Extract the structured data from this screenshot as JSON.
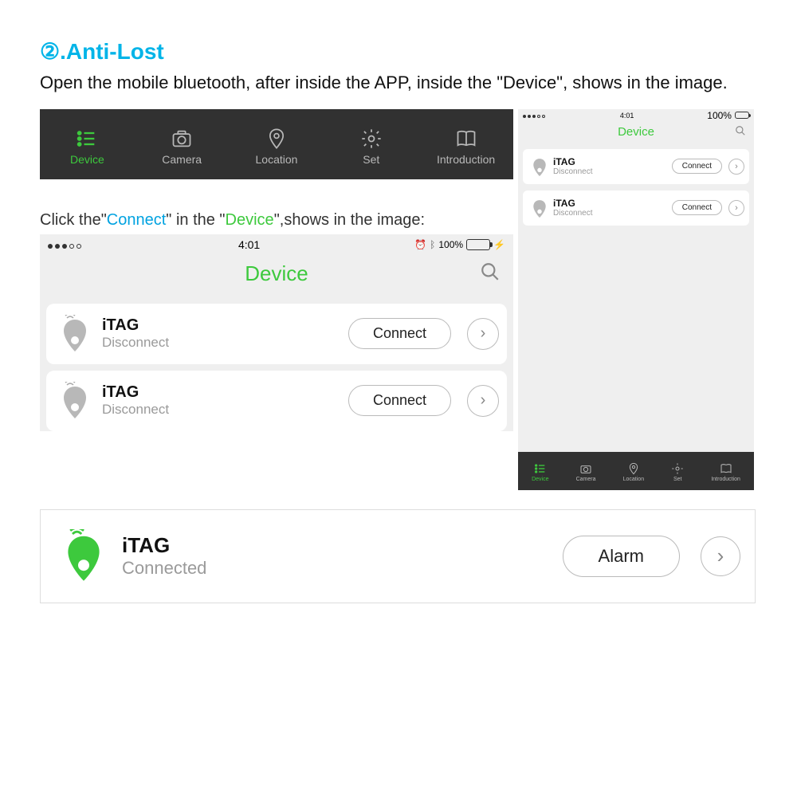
{
  "heading": "②.Anti-Lost",
  "description": "Open the mobile bluetooth, after inside the APP, inside the \"Device\", shows in the image.",
  "instruction_parts": {
    "p1": "Click the\"",
    "p2": "Connect",
    "p3": "\" in the \"",
    "p4": "Device",
    "p5": "\",shows in the image:"
  },
  "status": {
    "time": "4:01",
    "percent": "100%"
  },
  "tabs": [
    {
      "label": "Device"
    },
    {
      "label": "Camera"
    },
    {
      "label": "Location"
    },
    {
      "label": "Set"
    },
    {
      "label": "Introduction"
    }
  ],
  "app_title": "Device",
  "devices": [
    {
      "name": "iTAG",
      "status": "Disconnect",
      "button": "Connect"
    },
    {
      "name": "iTAG",
      "status": "Disconnect",
      "button": "Connect"
    }
  ],
  "connected": {
    "name": "iTAG",
    "status": "Connected",
    "button": "Alarm"
  }
}
